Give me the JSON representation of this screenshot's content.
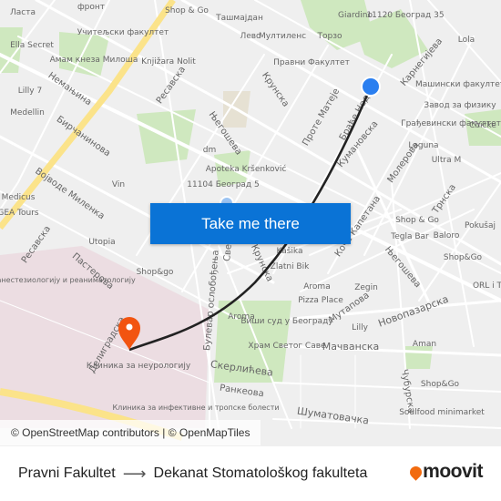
{
  "map": {
    "labels": [
      "фронт",
      "Shop & Go",
      "Ташмајдан",
      "Ласта",
      "Учитељски факултет",
      "Лево",
      "Мултиленс",
      "Торзо",
      "Giardino",
      "11120 Београд 35",
      "Lola",
      "Ella Secret",
      "Амам кнеза Милоша",
      "Knjižara Nolit",
      "Правни Факултет",
      "Немањина",
      "Ресавска",
      "Крунска",
      "Проте Матеје",
      "Карнегијева",
      "Машински факултет",
      "Lilly 7",
      "Medellin",
      "Бирчанинова",
      "Његошева",
      "Браће Недић",
      "Кумановска",
      "Завод за физику",
      "Грађевински факултет",
      "Chicke",
      "Laguna",
      "Ultra M",
      "dm",
      "Apoteka Kršenković",
      "11104 Београд 5",
      "Војводе Миленка",
      "Vin",
      "Medicus",
      "GEA Tours",
      "Молерова",
      "Трнска",
      "Shop & Go",
      "Pokušaj",
      "Tegla Bar",
      "Baloro",
      "Utopia",
      "Пастерова",
      "Kašika",
      "Zlatni Bik",
      "Коче Капетана",
      "Shop&Go",
      "Центар за анестезиологију и реаниматологију",
      "Shop&go",
      "Његошева",
      "Aroma",
      "Zegin",
      "ORL i T",
      "Pizza Place",
      "Aroma",
      "Виши суд у Београду",
      "Мутапова",
      "Lilly",
      "Новопазарска",
      "Храм Светог Саве",
      "Мачванска",
      "Aman",
      "Клиника за неурологију",
      "Делиградска",
      "Булевар ослобођења",
      "Скерлићева",
      "Чубурска",
      "Ранкеова",
      "Shop&Go",
      "Клиника за инфективне и тропске болести",
      "Шуматовачка",
      "Soulfood minimarket",
      "Крунска",
      "Светог Саве",
      "Ресавска"
    ],
    "attribution": "© OpenStreetMap contributors | © OpenMapTiles",
    "origin_marker_color": "#2a7ff0",
    "destination_marker_color": "#f25410",
    "route_color": "#222222"
  },
  "cta": {
    "label": "Take me there"
  },
  "footer": {
    "from": "Pravni Fakultet",
    "to": "Dekanat Stomatološkog fakulteta",
    "arrow": "⟶"
  },
  "brand": {
    "name": "moovit",
    "color": "#f26b0f"
  }
}
